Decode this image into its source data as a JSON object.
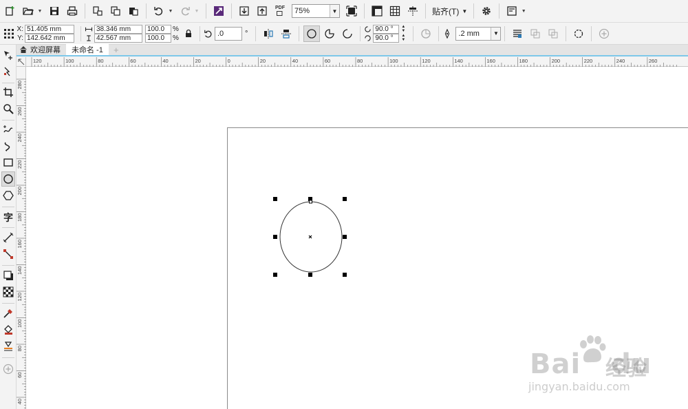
{
  "toolbar": {
    "pdf_label": "PDF",
    "zoom_value": "75%",
    "snap_label": "贴齐(T)"
  },
  "propbar": {
    "x_label": "X:",
    "x_value": "51.405 mm",
    "y_label": "Y:",
    "y_value": "142.642 mm",
    "width_value": "38.346 mm",
    "height_value": "42.567 mm",
    "scale_x": "100.0",
    "scale_y": "100.0",
    "percent": "%",
    "rotation": ".0",
    "degree": "°",
    "start_angle": "90.0 °",
    "end_angle": "90.0 °",
    "outline_width": ".2 mm"
  },
  "tabs": [
    {
      "label": "欢迎屏幕"
    },
    {
      "label": "未命名 -1"
    }
  ],
  "ruler": {
    "h_labels": [
      "120",
      "100",
      "80",
      "60",
      "40",
      "20",
      "0",
      "20",
      "40",
      "60",
      "80",
      "100",
      "120",
      "140",
      "160",
      "180",
      "200",
      "220",
      "240",
      "260"
    ],
    "v_labels": [
      "280",
      "260",
      "240",
      "220",
      "200",
      "180",
      "160",
      "140",
      "120",
      "100",
      "80",
      "60",
      "40"
    ]
  },
  "watermark": {
    "brand": "Bai",
    "brand_tail": "du",
    "cn": "经验",
    "url": "jingyan.baidu.com"
  },
  "colors": {
    "accent_tab_line": "#7ec8ea",
    "page_border": "#8a8a8a",
    "handle": "#000000"
  }
}
